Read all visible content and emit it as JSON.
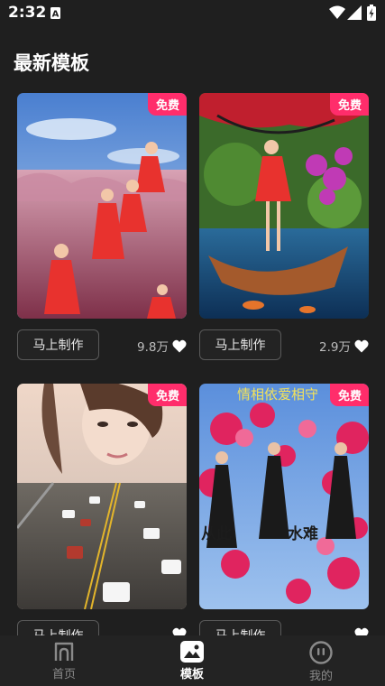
{
  "status_bar": {
    "time": "2:32",
    "notification_icon": "a-notification-icon",
    "icons": [
      "wifi-icon",
      "signal-icon",
      "battery-icon"
    ]
  },
  "page": {
    "title": "最新模板"
  },
  "templates": [
    {
      "badge": "免费",
      "button": "马上制作",
      "likes": "9.8万",
      "thumbnail": "woman in red dress among pink grass"
    },
    {
      "badge": "免费",
      "button": "马上制作",
      "likes": "2.9万",
      "thumbnail": "woman in red dress on wooden boat"
    },
    {
      "badge": "免费",
      "button": "马上制作",
      "likes": "",
      "thumbnail": "portrait over highway traffic"
    },
    {
      "badge": "免费",
      "button": "马上制作",
      "likes": "",
      "thumbnail": "three women in black dresses with pink flowers"
    }
  ],
  "thumbnail_text": {
    "top": "情相依爱相守",
    "bottom_left": "从此",
    "bottom_right": "水难"
  },
  "bottom_nav": [
    {
      "label": "首页",
      "icon": "home-icon"
    },
    {
      "label": "模板",
      "icon": "template-icon",
      "active": true
    },
    {
      "label": "我的",
      "icon": "profile-icon"
    }
  ],
  "colors": {
    "background": "#1f1f1f",
    "badge": "#ff2d6b",
    "nav_bg": "#232323"
  }
}
